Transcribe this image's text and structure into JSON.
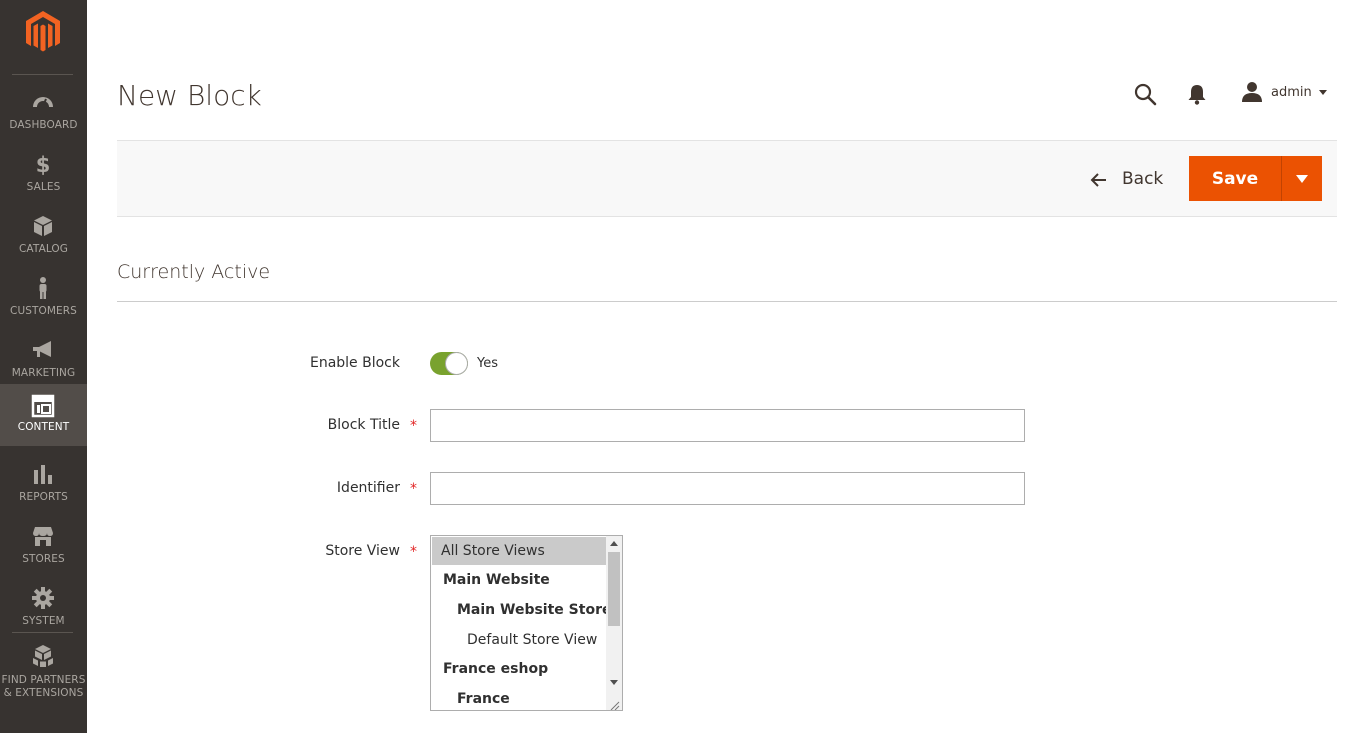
{
  "sidebar": {
    "logo": "magento-logo",
    "items": [
      {
        "label": "DASHBOARD",
        "icon": "dashboard-icon"
      },
      {
        "label": "SALES",
        "icon": "dollar-icon"
      },
      {
        "label": "CATALOG",
        "icon": "box-icon"
      },
      {
        "label": "CUSTOMERS",
        "icon": "person-icon"
      },
      {
        "label": "MARKETING",
        "icon": "megaphone-icon"
      },
      {
        "label": "CONTENT",
        "icon": "layout-icon",
        "active": true
      },
      {
        "label": "REPORTS",
        "icon": "bar-chart-icon"
      },
      {
        "label": "STORES",
        "icon": "store-icon"
      },
      {
        "label": "SYSTEM",
        "icon": "gear-icon"
      },
      {
        "label_line1": "FIND PARTNERS",
        "label_line2": "& EXTENSIONS",
        "icon": "cubes-icon"
      }
    ]
  },
  "header": {
    "title": "New Block",
    "user": "admin"
  },
  "actions": {
    "back_label": "Back",
    "save_label": "Save"
  },
  "section": {
    "title": "Currently Active"
  },
  "form": {
    "enable_block": {
      "label": "Enable Block",
      "value": "Yes",
      "enabled": true
    },
    "block_title": {
      "label": "Block Title",
      "required_mark": "*",
      "value": ""
    },
    "identifier": {
      "label": "Identifier",
      "required_mark": "*",
      "value": ""
    },
    "store_view": {
      "label": "Store View",
      "required_mark": "*",
      "options": [
        {
          "text": "All Store Views",
          "selected": true
        },
        {
          "text": "Main Website"
        },
        {
          "text": "Main Website Store"
        },
        {
          "text": "Default Store View"
        },
        {
          "text": "France eshop"
        },
        {
          "text": "France"
        }
      ]
    }
  },
  "colors": {
    "sidebar_bg": "#373330",
    "sidebar_active": "#524d49",
    "accent": "#eb5202",
    "toggle_on": "#79a22e",
    "required": "#e22626"
  }
}
